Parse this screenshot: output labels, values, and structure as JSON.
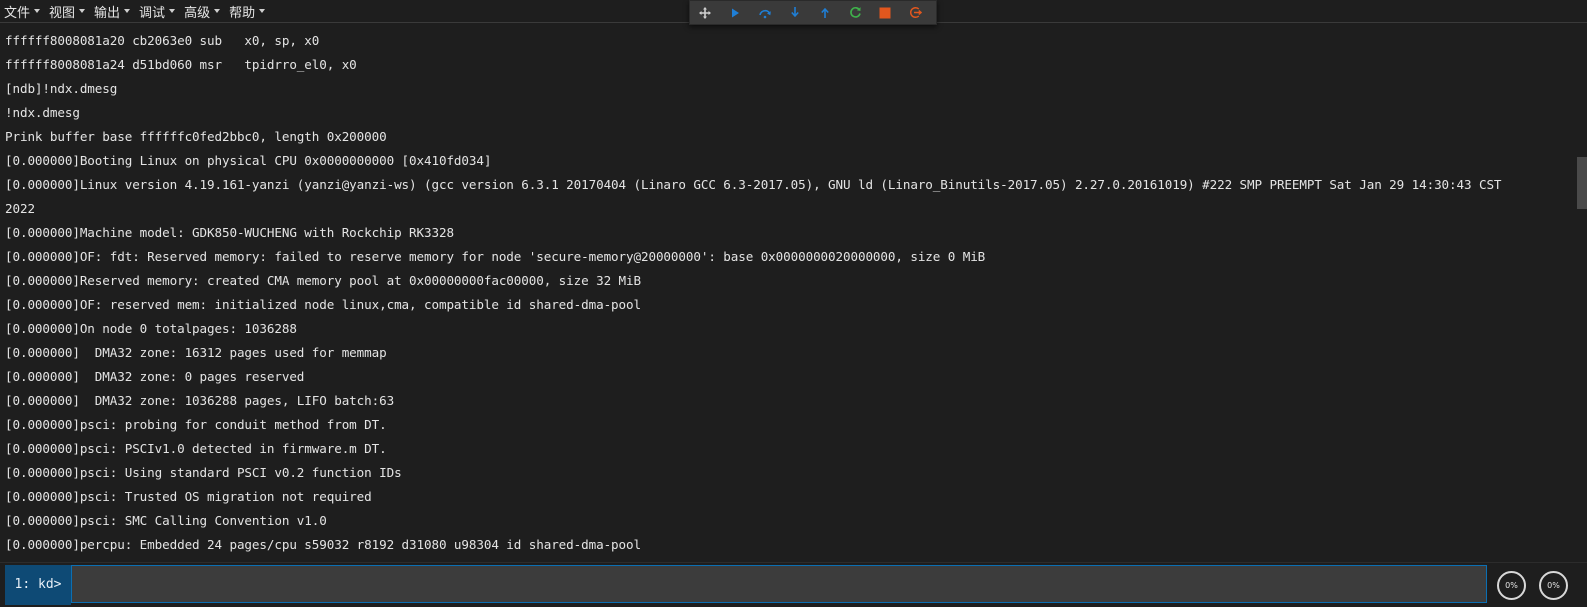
{
  "menubar": {
    "items": [
      {
        "label": "文件"
      },
      {
        "label": "视图"
      },
      {
        "label": "输出"
      },
      {
        "label": "调试"
      },
      {
        "label": "高级"
      },
      {
        "label": "帮助"
      }
    ]
  },
  "toolbar": {
    "buttons": [
      {
        "icon": "move-icon",
        "color": "#d0d0d0"
      },
      {
        "icon": "continue-icon",
        "color": "#1f7fd6"
      },
      {
        "icon": "step-over-icon",
        "color": "#1f7fd6"
      },
      {
        "icon": "step-into-icon",
        "color": "#1f7fd6"
      },
      {
        "icon": "step-out-icon",
        "color": "#1f7fd6"
      },
      {
        "icon": "restart-icon",
        "color": "#3fb14b"
      },
      {
        "icon": "stop-icon",
        "color": "#e2571e"
      },
      {
        "icon": "disconnect-icon",
        "color": "#e2571e"
      }
    ]
  },
  "output": {
    "lines": [
      "ffffff8008081a20 cb2063e0 sub   x0, sp, x0",
      "ffffff8008081a24 d51bd060 msr   tpidrro_el0, x0",
      "[ndb]!ndx.dmesg",
      "!ndx.dmesg",
      "Prink buffer base ffffffc0fed2bbc0, length 0x200000",
      "[0.000000]Booting Linux on physical CPU 0x0000000000 [0x410fd034]",
      "[0.000000]Linux version 4.19.161-yanzi (yanzi@yanzi-ws) (gcc version 6.3.1 20170404 (Linaro GCC 6.3-2017.05), GNU ld (Linaro_Binutils-2017.05) 2.27.0.20161019) #222 SMP PREEMPT Sat Jan 29 14:30:43 CST",
      "2022",
      "[0.000000]Machine model: GDK850-WUCHENG with Rockchip RK3328",
      "[0.000000]OF: fdt: Reserved memory: failed to reserve memory for node 'secure-memory@20000000': base 0x0000000020000000, size 0 MiB",
      "[0.000000]Reserved memory: created CMA memory pool at 0x00000000fac00000, size 32 MiB",
      "[0.000000]OF: reserved mem: initialized node linux,cma, compatible id shared-dma-pool",
      "[0.000000]On node 0 totalpages: 1036288",
      "[0.000000]  DMA32 zone: 16312 pages used for memmap",
      "[0.000000]  DMA32 zone: 0 pages reserved",
      "[0.000000]  DMA32 zone: 1036288 pages, LIFO batch:63",
      "[0.000000]psci: probing for conduit method from DT.",
      "[0.000000]psci: PSCIv1.0 detected in firmware.m DT.",
      "[0.000000]psci: Using standard PSCI v0.2 function IDs",
      "[0.000000]psci: Trusted OS migration not required",
      "[0.000000]psci: SMC Calling Convention v1.0",
      "[0.000000]percpu: Embedded 24 pages/cpu s59032 r8192 d31080 u98304 id shared-dma-pool"
    ]
  },
  "command": {
    "prompt": "1: kd>",
    "value": "",
    "placeholder": ""
  },
  "gauges": [
    {
      "label": "0%"
    },
    {
      "label": "0%"
    }
  ],
  "colors": {
    "accent": "#0e4a75",
    "input_border": "#0b6fb3",
    "background": "#1e1e1e"
  }
}
